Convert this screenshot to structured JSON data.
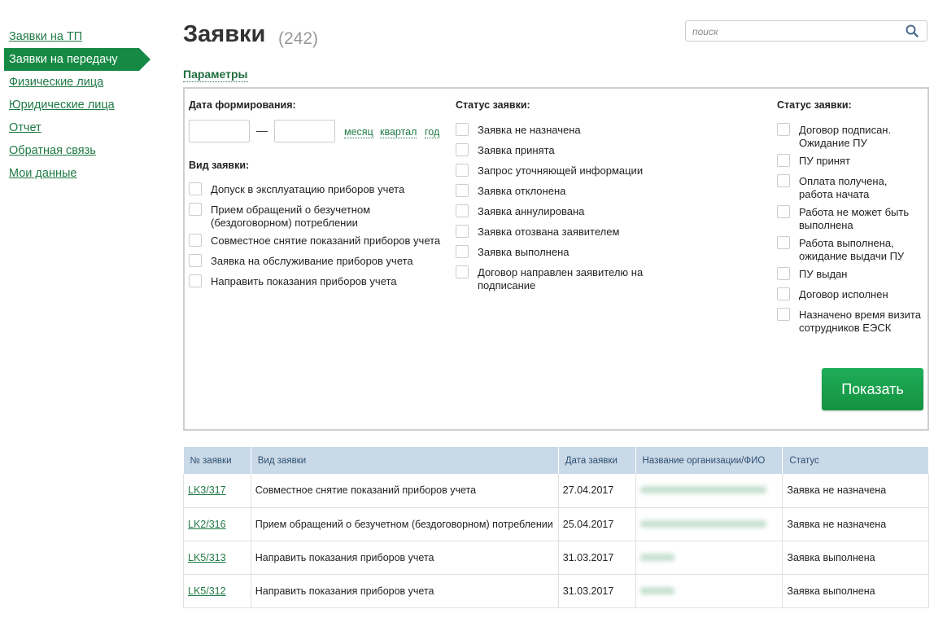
{
  "sidebar": {
    "items": [
      {
        "label": "Заявки на ТП"
      },
      {
        "label": "Заявки на передачу",
        "active": true
      },
      {
        "label": "Физические лица"
      },
      {
        "label": "Юридические лица"
      },
      {
        "label": "Отчет"
      },
      {
        "label": "Обратная связь"
      },
      {
        "label": "Мои данные"
      }
    ]
  },
  "header": {
    "title": "Заявки",
    "count": "(242)"
  },
  "search": {
    "placeholder": "поиск",
    "icon": "search-icon"
  },
  "params": {
    "title": "Параметры",
    "date_label": "Дата формирования:",
    "date_dash": "—",
    "periods": [
      "месяц",
      "квартал",
      "год"
    ],
    "type_label": "Вид заявки:",
    "types": [
      "Допуск в эксплуатацию приборов учета",
      "Прием обращений о безучетном (бездоговорном) потреблении",
      "Совместное снятие показаний приборов учета",
      "Заявка на обслуживание приборов учета",
      "Направить показания приборов учета"
    ],
    "status_label_1": "Статус заявки:",
    "statuses_1": [
      "Заявка не назначена",
      "Заявка принята",
      "Запрос уточняющей информации",
      "Заявка отклонена",
      "Заявка аннулирована",
      "Заявка отозвана заявителем",
      "Заявка выполнена",
      "Договор направлен заявителю на подписание"
    ],
    "status_label_2": "Статус заявки:",
    "statuses_2": [
      "Договор подписан. Ожидание ПУ",
      "ПУ принят",
      "Оплата получена, работа начата",
      "Работа не может быть выполнена",
      "Работа выполнена, ожидание выдачи ПУ",
      "ПУ выдан",
      "Договор исполнен",
      "Назначено время визита сотрудников ЕЭСК"
    ],
    "show_button": "Показать"
  },
  "table": {
    "columns": [
      "№ заявки",
      "Вид заявки",
      "Дата заявки",
      "Название организации/ФИО",
      "Статус"
    ],
    "rows": [
      {
        "id": "LK3/317",
        "type": "Совместное снятие показаний приборов учета",
        "date": "27.04.2017",
        "status": "Заявка не назначена"
      },
      {
        "id": "LK2/316",
        "type": "Прием обращений о безучетном (бездоговорном) потреблении",
        "date": "25.04.2017",
        "status": "Заявка не назначена"
      },
      {
        "id": "LK5/313",
        "type": "Направить показания приборов учета",
        "date": "31.03.2017",
        "status": "Заявка выполнена"
      },
      {
        "id": "LK5/312",
        "type": "Направить показания приборов учета",
        "date": "31.03.2017",
        "status": "Заявка выполнена"
      }
    ]
  },
  "colors": {
    "accent": "#168a45",
    "link": "#1f7a44",
    "table_header": "#c9d9e8"
  }
}
